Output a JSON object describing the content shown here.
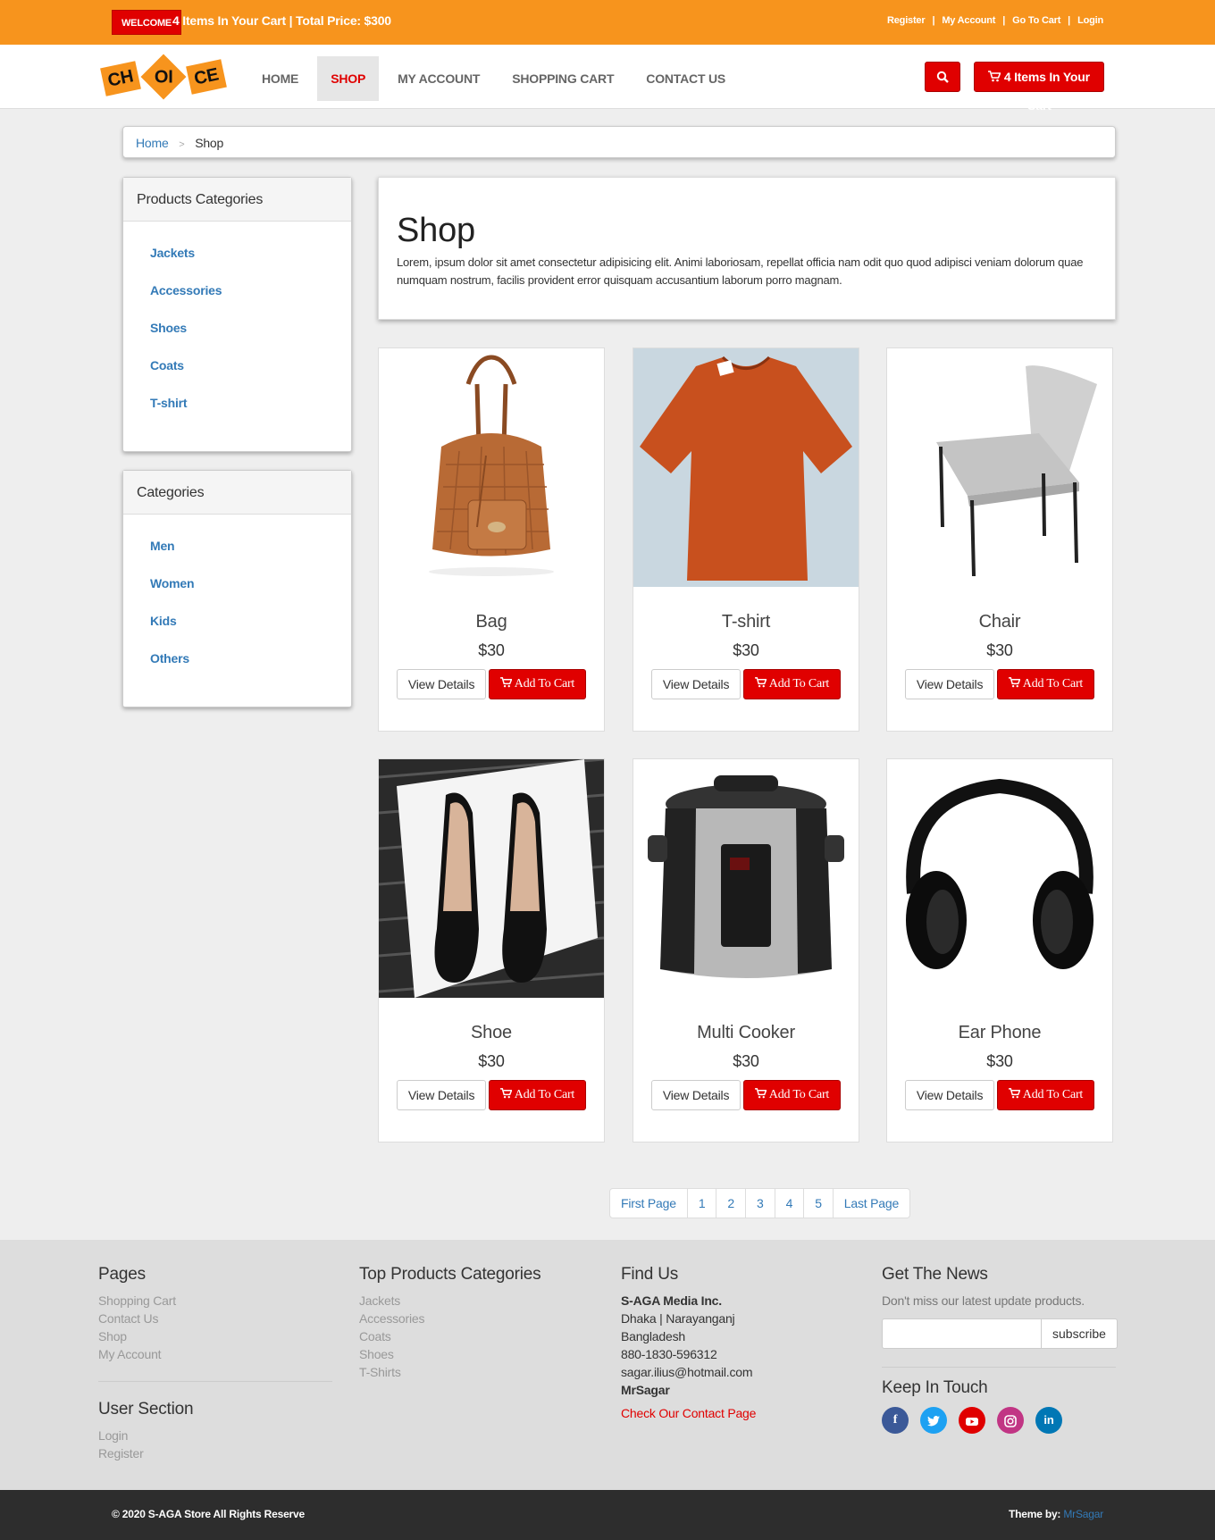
{
  "topbar": {
    "welcome": "WELCOME",
    "info": "4 Items In Your Cart | Total Price: $300",
    "links": [
      "Register",
      "My Account",
      "Go To Cart",
      "Login"
    ]
  },
  "logo": {
    "parts": [
      "CH",
      "OI",
      "CE"
    ]
  },
  "nav": {
    "items": [
      "HOME",
      "SHOP",
      "MY ACCOUNT",
      "SHOPPING CART",
      "CONTACT US"
    ],
    "active": "SHOP",
    "cart_button": "4 Items In Your Cart"
  },
  "breadcrumb": {
    "home": "Home",
    "current": "Shop"
  },
  "sidebar": {
    "products_categories": {
      "title": "Products Categories",
      "items": [
        "Jackets",
        "Accessories",
        "Shoes",
        "Coats",
        "T-shirt"
      ]
    },
    "categories": {
      "title": "Categories",
      "items": [
        "Men",
        "Women",
        "Kids",
        "Others"
      ]
    }
  },
  "shop": {
    "title": "Shop",
    "description": "Lorem, ipsum dolor sit amet consectetur adipisicing elit. Animi laboriosam, repellat officia nam odit quo quod adipisci veniam dolorum quae numquam nostrum, facilis provident error quisquam accusantium laborum porro magnam."
  },
  "products": [
    {
      "name": "Bag",
      "price": "$30",
      "view": "View Details",
      "add": "Add To Cart"
    },
    {
      "name": "T-shirt",
      "price": "$30",
      "view": "View Details",
      "add": "Add To Cart"
    },
    {
      "name": "Chair",
      "price": "$30",
      "view": "View Details",
      "add": "Add To Cart"
    },
    {
      "name": "Shoe",
      "price": "$30",
      "view": "View Details",
      "add": "Add To Cart"
    },
    {
      "name": "Multi Cooker",
      "price": "$30",
      "view": "View Details",
      "add": "Add To Cart"
    },
    {
      "name": "Ear Phone",
      "price": "$30",
      "view": "View Details",
      "add": "Add To Cart"
    }
  ],
  "pagination": [
    "First Page",
    "1",
    "2",
    "3",
    "4",
    "5",
    "Last Page"
  ],
  "footer": {
    "pages": {
      "title": "Pages",
      "links": [
        "Shopping Cart",
        "Contact Us",
        "Shop",
        "My Account"
      ]
    },
    "user_section": {
      "title": "User Section",
      "links": [
        "Login",
        "Register"
      ]
    },
    "top_categories": {
      "title": "Top Products Categories",
      "links": [
        "Jackets",
        "Accessories",
        "Coats",
        "Shoes",
        "T-Shirts"
      ]
    },
    "find_us": {
      "title": "Find Us",
      "company": "S-AGA Media Inc.",
      "lines": [
        "Dhaka | Narayanganj",
        "Bangladesh",
        "880-1830-596312",
        "sagar.ilius@hotmail.com"
      ],
      "name": "MrSagar",
      "contact_link": "Check Our Contact Page"
    },
    "news": {
      "title": "Get The News",
      "text": "Don't miss our latest update products.",
      "subscribe": "subscribe"
    },
    "touch": {
      "title": "Keep In Touch"
    }
  },
  "bottom": {
    "copyright": "© 2020 S-AGA Store All Rights Reserve",
    "theme_by": "Theme by:",
    "author": "MrSagar"
  },
  "colors": {
    "orange": "#f7941d",
    "red": "#e00000",
    "link": "#337ab7"
  }
}
